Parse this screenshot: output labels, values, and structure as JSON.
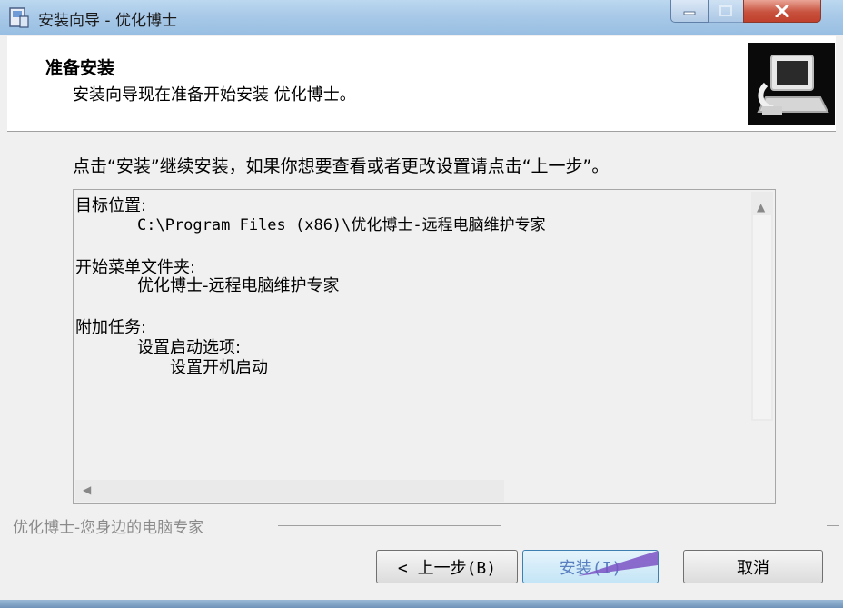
{
  "window": {
    "title": "安装向导 - 优化博士",
    "min_icon": "minimize-icon",
    "max_icon": "maximize-icon",
    "close_icon": "close-icon"
  },
  "header": {
    "title": "准备安装",
    "subtitle": "安装向导现在准备开始安装 优化博士。"
  },
  "instruction": "点击“安装”继续安装，如果你想要查看或者更改设置请点击“上一步”。",
  "memo": {
    "lines": [
      "目标位置:",
      "C:\\Program Files (x86)\\优化博士-远程电脑维护专家",
      "开始菜单文件夹:",
      "优化博士-远程电脑维护专家",
      "附加任务:",
      "设置启动选项:",
      "设置开机启动"
    ]
  },
  "brand": "优化博士-您身边的电脑专家",
  "buttons": {
    "back": "< 上一步(B)",
    "install": "安装(I)",
    "cancel": "取消"
  },
  "colors": {
    "titlebar": "#a9c9e8",
    "close": "#c8523f",
    "default_button_border": "#3c7fb1",
    "annotation_arrow": "#7b54c4"
  }
}
